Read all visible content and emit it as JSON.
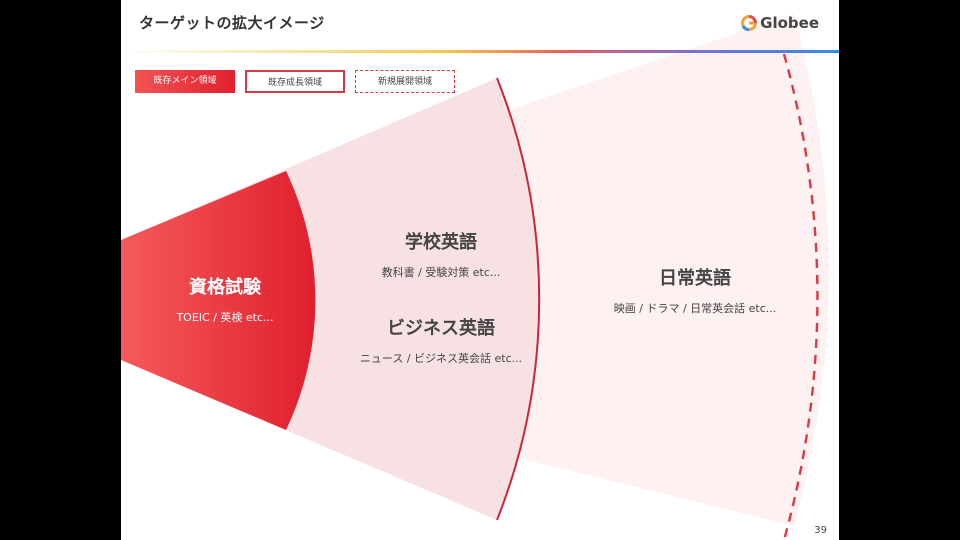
{
  "slide": {
    "title": "ターゲットの拡大イメージ",
    "logo": "Globee",
    "page_number": "39"
  },
  "legend": {
    "main": "既存メイン領域",
    "growth": "既存成長領域",
    "new": "新規展開領域"
  },
  "zones": {
    "core": {
      "title": "資格試験",
      "sub": "TOEIC / 英検 etc..."
    },
    "school": {
      "title": "学校英語",
      "sub": "教科書 / 受験対策 etc..."
    },
    "business": {
      "title": "ビジネス英語",
      "sub": "ニュース / ビジネス英会話 etc..."
    },
    "daily": {
      "title": "日常英語",
      "sub": "映画 / ドラマ / 日常英会話 etc..."
    }
  },
  "colors": {
    "accent": "#e2202f",
    "growth_fill": "#f8e1e3",
    "outer_fill": "#fdf1f2"
  }
}
